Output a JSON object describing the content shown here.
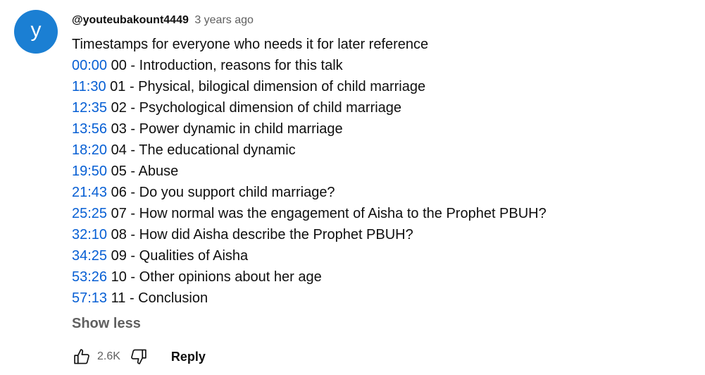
{
  "comment": {
    "avatar_letter": "y",
    "author": "@youteubakount4449",
    "posted": "3 years ago",
    "intro": "Timestamps for everyone who needs it for later reference",
    "timestamps": [
      {
        "time": "00:00",
        "text": " 00 - Introduction, reasons for this talk"
      },
      {
        "time": "11:30",
        "text": " 01 - Physical, bilogical dimension of child marriage"
      },
      {
        "time": "12:35",
        "text": " 02 - Psychological dimension of child marriage"
      },
      {
        "time": "13:56",
        "text": " 03 - Power dynamic in child marriage"
      },
      {
        "time": "18:20",
        "text": " 04 - The educational dynamic"
      },
      {
        "time": "19:50",
        "text": " 05 - Abuse"
      },
      {
        "time": "21:43",
        "text": " 06 - Do you support child marriage?"
      },
      {
        "time": "25:25",
        "text": " 07 - How normal was the engagement of Aisha to the Prophet PBUH?"
      },
      {
        "time": "32:10",
        "text": " 08 - How did Aisha describe the Prophet PBUH?"
      },
      {
        "time": "34:25",
        "text": " 09 - Qualities of Aisha"
      },
      {
        "time": "53:26",
        "text": " 10 - Other opinions about her age"
      },
      {
        "time": "57:13",
        "text": " 11 - Conclusion"
      }
    ],
    "show_less_label": "Show less",
    "like_count": "2.6K",
    "reply_label": "Reply",
    "icons": {
      "like": "thumb-up-icon",
      "dislike": "thumb-down-icon"
    },
    "colors": {
      "avatar_bg": "#1b7fd3",
      "timestamp_link": "#065fd4",
      "secondary_text": "#606060"
    }
  }
}
